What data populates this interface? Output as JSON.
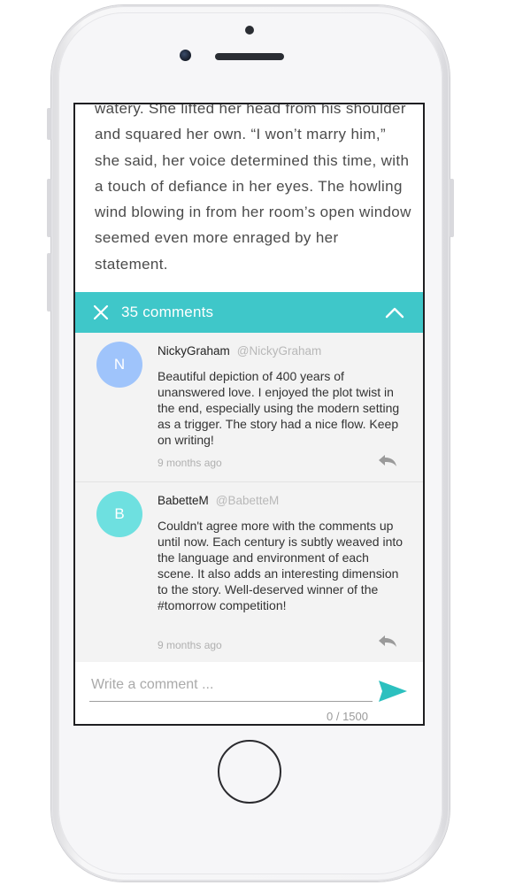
{
  "colors": {
    "accent": "#3fc7c9",
    "avatar_n": "#9fc4fb",
    "avatar_b": "#6ee0e0",
    "send": "#2cc0bf"
  },
  "story": {
    "text": "watery. She lifted her head from his shoulder and squared her own. “I won’t marry him,” she said, her voice determined this time, with a touch of defiance in her eyes. The howling wind blowing in from her room’s open window seemed even more enraged by her statement."
  },
  "comments_bar": {
    "label": "35 comments",
    "close_icon": "close-icon",
    "collapse_icon": "chevron-up-icon"
  },
  "comments": [
    {
      "initial": "N",
      "username": "NickyGraham",
      "handle": "@NickyGraham",
      "text": "Beautiful depiction of 400 years of unanswered love. I enjoyed the plot twist in the end, especially using the modern setting as a trigger. The story had a nice flow. Keep on writing!",
      "time": "9 months ago",
      "reply_icon": "reply-icon"
    },
    {
      "initial": "B",
      "username": "BabetteM",
      "handle": "@BabetteM",
      "text": "Couldn't agree more with the comments up until now. Each century is subtly weaved into the language and environment of each scene. It also adds an interesting dimension to the story. Well-deserved winner of the #tomorrow competition!",
      "time": "9 months ago",
      "reply_icon": "reply-icon"
    }
  ],
  "composer": {
    "placeholder": "Write a comment ...",
    "value": "",
    "counter": "0 / 1500",
    "send_icon": "send-icon"
  }
}
